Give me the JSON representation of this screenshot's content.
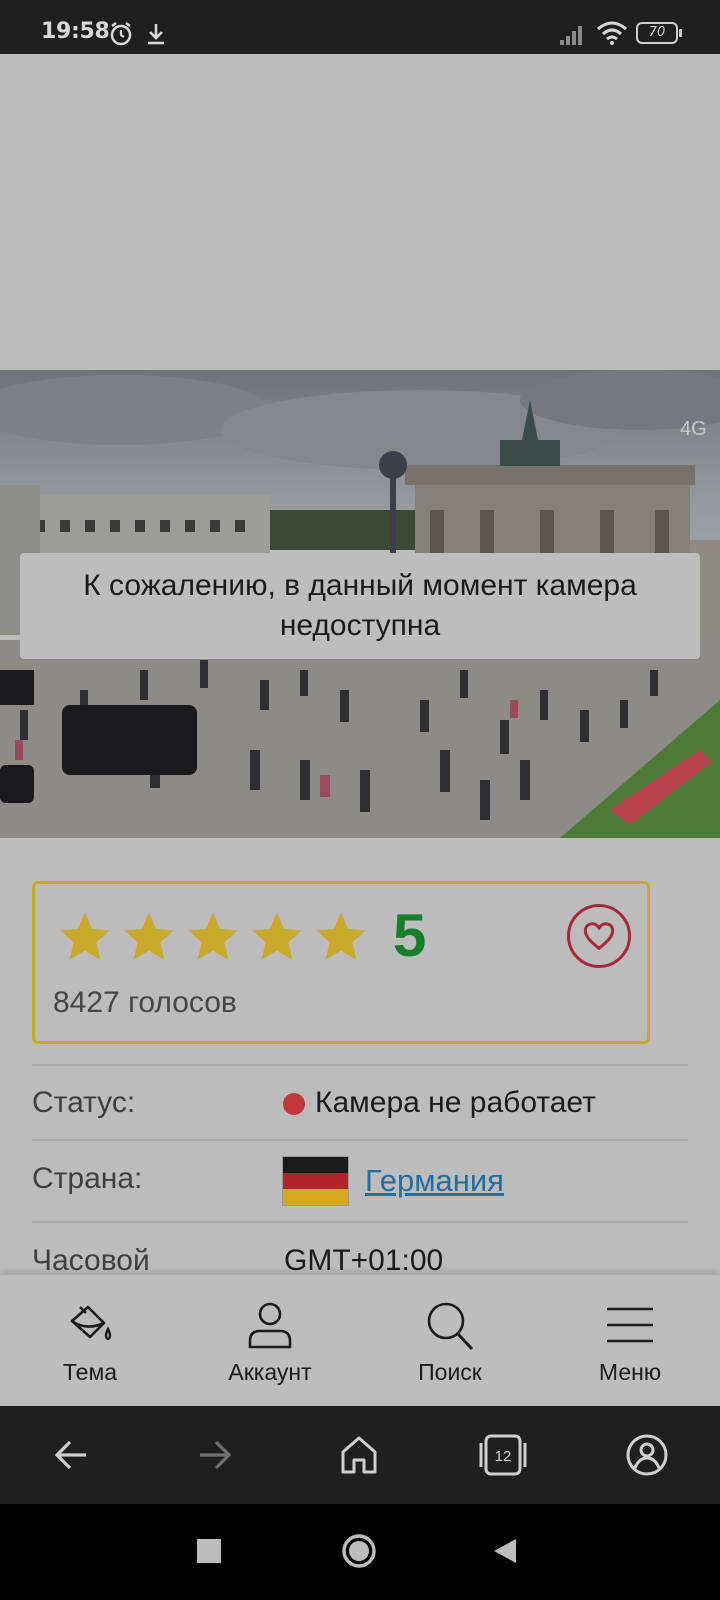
{
  "status_bar": {
    "time": "19:58",
    "battery": "70",
    "icons": [
      "alarm-icon",
      "download-icon",
      "signal-icon",
      "wifi-icon",
      "battery-icon"
    ]
  },
  "camera": {
    "message": "К сожалению, в данный момент камера недоступна",
    "watermark": "4G"
  },
  "rating": {
    "stars": 5,
    "max_stars": 5,
    "value": "5",
    "votes": "8427 голосов",
    "star_color": "#c9a92a",
    "value_color": "#13802a"
  },
  "info": {
    "status_label": "Статус:",
    "status_value": "Камера не работает",
    "country_label": "Страна:",
    "country_value": "Германия",
    "timezone_label": "Часовой",
    "timezone_value": "GMT+01:00"
  },
  "site_nav": [
    {
      "label": "Тема",
      "icon": "paint-bucket-icon"
    },
    {
      "label": "Аккаунт",
      "icon": "user-icon"
    },
    {
      "label": "Поиск",
      "icon": "search-icon"
    },
    {
      "label": "Меню",
      "icon": "menu-icon"
    }
  ],
  "browser": {
    "tabs_count": "12"
  }
}
